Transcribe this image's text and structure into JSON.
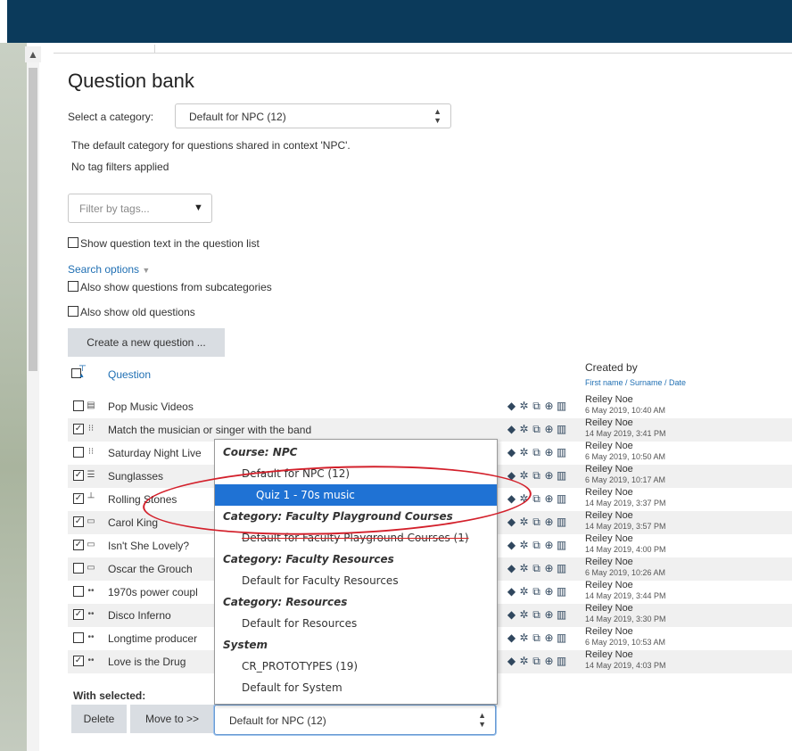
{
  "page": {
    "title": "Question bank"
  },
  "category": {
    "label": "Select a category:",
    "selected": "Default for NPC (12)",
    "description": "The default category for questions shared in context 'NPC'.",
    "tag_status": "No tag filters applied",
    "tag_filter_placeholder": "Filter by tags..."
  },
  "options": {
    "show_question_text": "Show question text in the question list",
    "search_options": "Search options",
    "subcategories": "Also show questions from subcategories",
    "old_questions": "Also show old questions"
  },
  "create_button": "Create a new question ...",
  "table": {
    "question_header": "Question",
    "created_by": "Created by",
    "created_by_sub": "First name / Surname / Date",
    "rows": [
      {
        "name": "Pop Music Videos",
        "checked": false,
        "type_icon": "essay-icon",
        "creator": "Reiley Noe",
        "date": "6 May 2019, 10:40 AM"
      },
      {
        "name": "Match the musician or singer with the band",
        "checked": true,
        "type_icon": "matching-icon",
        "creator": "Reiley Noe",
        "date": "14 May 2019, 3:41 PM"
      },
      {
        "name": "Saturday Night Live",
        "checked": false,
        "type_icon": "matching-icon",
        "creator": "Reiley Noe",
        "date": "6 May 2019, 10:50 AM"
      },
      {
        "name": "Sunglasses",
        "checked": true,
        "type_icon": "multichoice-icon",
        "creator": "Reiley Noe",
        "date": "6 May 2019, 10:17 AM"
      },
      {
        "name": "Rolling Stones",
        "checked": true,
        "type_icon": "numerical-icon",
        "creator": "Reiley Noe",
        "date": "14 May 2019, 3:37 PM"
      },
      {
        "name": "Carol King",
        "checked": true,
        "type_icon": "shortanswer-icon",
        "creator": "Reiley Noe",
        "date": "14 May 2019, 3:57 PM"
      },
      {
        "name": "Isn't She Lovely?",
        "checked": true,
        "type_icon": "shortanswer-icon",
        "creator": "Reiley Noe",
        "date": "14 May 2019, 4:00 PM"
      },
      {
        "name": "Oscar the Grouch",
        "checked": false,
        "type_icon": "shortanswer-icon",
        "creator": "Reiley Noe",
        "date": "6 May 2019, 10:26 AM"
      },
      {
        "name": "1970s power coupl",
        "checked": false,
        "type_icon": "truefalse-icon",
        "creator": "Reiley Noe",
        "date": "14 May 2019, 3:44 PM"
      },
      {
        "name": "Disco Inferno",
        "checked": true,
        "type_icon": "truefalse-icon",
        "creator": "Reiley Noe",
        "date": "14 May 2019, 3:30 PM"
      },
      {
        "name": "Longtime producer",
        "checked": false,
        "type_icon": "truefalse-icon",
        "creator": "Reiley Noe",
        "date": "6 May 2019, 10:53 AM"
      },
      {
        "name": "Love is the Drug",
        "checked": true,
        "type_icon": "truefalse-icon",
        "creator": "Reiley Noe",
        "date": "14 May 2019, 4:03 PM"
      }
    ]
  },
  "bulk": {
    "with_selected": "With selected:",
    "delete": "Delete",
    "move_to": "Move to >>",
    "target": "Default for NPC (12)"
  },
  "dropdown": {
    "items": [
      {
        "kind": "group",
        "label": "Course: NPC"
      },
      {
        "kind": "option",
        "label": "Default for NPC (12)"
      },
      {
        "kind": "selected",
        "label": "Quiz 1 - 70s music"
      },
      {
        "kind": "group",
        "label": "Category: Faculty Playground Courses"
      },
      {
        "kind": "option-struck",
        "label": "Default for Faculty Playground Courses (1)"
      },
      {
        "kind": "group",
        "label": "Category: Faculty Resources"
      },
      {
        "kind": "option",
        "label": "Default for Faculty Resources"
      },
      {
        "kind": "group",
        "label": "Category: Resources"
      },
      {
        "kind": "option",
        "label": "Default for Resources"
      },
      {
        "kind": "group",
        "label": "System"
      },
      {
        "kind": "option",
        "label": "CR_PROTOTYPES (19)"
      },
      {
        "kind": "option",
        "label": "Default for System"
      }
    ]
  },
  "colors": {
    "header_bar": "#0b3a5b",
    "link": "#1f6fb3",
    "highlight": "#1f72d4",
    "annotation": "#d3202b"
  }
}
